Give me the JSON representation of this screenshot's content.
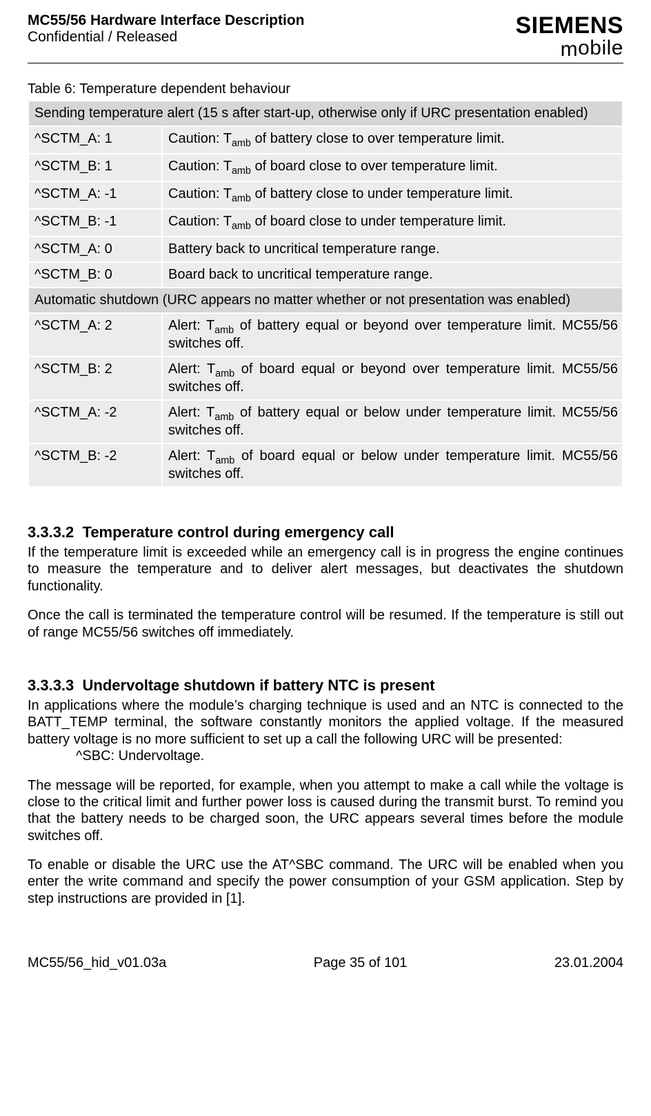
{
  "header": {
    "title": "MC55/56 Hardware Interface Description",
    "subtitle": "Confidential / Released",
    "logo_top": "SIEMENS",
    "logo_bottom_m": "m",
    "logo_bottom_rest": "obile"
  },
  "table": {
    "caption": "Table 6: Temperature dependent behaviour",
    "section1_header": "Sending temperature alert (15 s after start-up, otherwise only if URC presentation enabled)",
    "rows1": [
      {
        "c1": "^SCTM_A:  1",
        "c2a": "Caution: T",
        "c2sub": "amb",
        "c2b": " of battery close to over temperature limit."
      },
      {
        "c1": "^SCTM_B:  1",
        "c2a": "Caution: T",
        "c2sub": "amb",
        "c2b": " of board close to over temperature limit."
      },
      {
        "c1": "^SCTM_A:  -1",
        "c2a": "Caution: T",
        "c2sub": "amb",
        "c2b": " of battery close to under temperature limit."
      },
      {
        "c1": "^SCTM_B:  -1",
        "c2a": "Caution: T",
        "c2sub": "amb",
        "c2b": " of board close to under temperature limit."
      },
      {
        "c1": "^SCTM_A: 0",
        "c2a": "Battery back to uncritical temperature range.",
        "c2sub": "",
        "c2b": ""
      },
      {
        "c1": "^SCTM_B: 0",
        "c2a": "Board back to uncritical temperature range.",
        "c2sub": "",
        "c2b": ""
      }
    ],
    "section2_header": "Automatic shutdown (URC appears no matter whether or not presentation was enabled)",
    "rows2": [
      {
        "c1": "^SCTM_A:  2",
        "c2a": "Alert: T",
        "c2sub": "amb",
        "c2b": " of battery equal or beyond over temperature limit. MC55/56 switches off."
      },
      {
        "c1": "^SCTM_B:  2",
        "c2a": "Alert: T",
        "c2sub": "amb",
        "c2b": " of board equal or beyond over temperature limit. MC55/56 switches off."
      },
      {
        "c1": "^SCTM_A:  -2",
        "c2a": "Alert: T",
        "c2sub": "amb",
        "c2b": " of battery equal or below under temperature limit. MC55/56 switches off."
      },
      {
        "c1": "^SCTM_B:  -2",
        "c2a": "Alert: T",
        "c2sub": "amb",
        "c2b": " of board equal or below under temperature limit. MC55/56 switches off."
      }
    ]
  },
  "sec1": {
    "num": "3.3.3.2",
    "title": "Temperature control during emergency call",
    "p1": "If the temperature limit is exceeded while an emergency call is in progress the engine continues to measure the temperature and to deliver alert messages, but deactivates the shutdown functionality.",
    "p2": "Once the call is terminated the temperature control will be resumed. If the temperature is still out of range MC55/56 switches off immediately."
  },
  "sec2": {
    "num": "3.3.3.3",
    "title": "Undervoltage shutdown if battery NTC is present",
    "p1": "In applications where the module’s charging technique is used and an NTC is connected to the BATT_TEMP terminal, the software constantly monitors the applied voltage. If the measured battery voltage is no more sufficient to set up a call the following URC will be presented:",
    "p1_indent": "^SBC:  Undervoltage.",
    "p2": "The message will be reported, for example, when you attempt to make a call while the voltage is close to the critical limit and further power loss is caused during the transmit burst. To remind you that the battery needs to be charged soon, the URC appears several times before the module switches off.",
    "p3": "To enable or disable the URC use the AT^SBC command. The URC will be enabled when you enter the write command and specify the power consumption of your GSM application. Step by step instructions are provided in [1]."
  },
  "footer": {
    "left": "MC55/56_hid_v01.03a",
    "center": "Page 35 of 101",
    "right": "23.01.2004"
  }
}
